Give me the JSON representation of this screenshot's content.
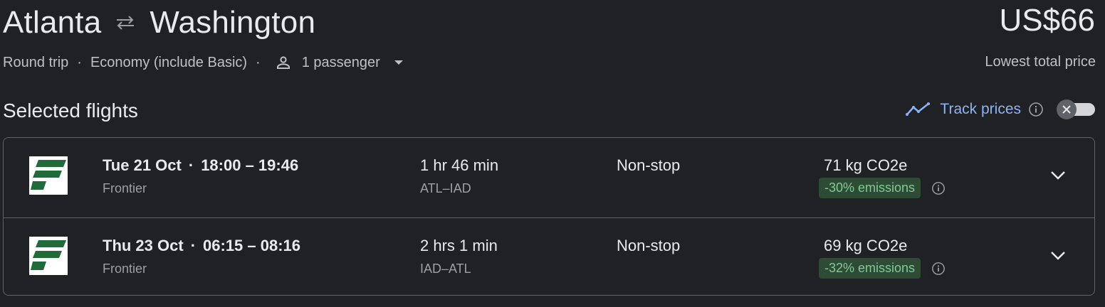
{
  "header": {
    "origin": "Atlanta",
    "destination": "Washington",
    "swap_icon": "swap-arrows-icon",
    "price": "US$66",
    "price_caption": "Lowest total price",
    "trip_type": "Round trip",
    "cabin": "Economy (include Basic)",
    "passengers": "1 passenger"
  },
  "section": {
    "title": "Selected flights",
    "track_label": "Track prices"
  },
  "flights": [
    {
      "date": "Tue 21 Oct",
      "times": "18:00 – 19:46",
      "airline": "Frontier",
      "duration": "1 hr 46 min",
      "route": "ATL–IAD",
      "stops": "Non-stop",
      "co2": "71 kg CO2e",
      "emissions": "-30% emissions"
    },
    {
      "date": "Thu 23 Oct",
      "times": "06:15 – 08:16",
      "airline": "Frontier",
      "duration": "2 hrs 1 min",
      "route": "IAD–ATL",
      "stops": "Non-stop",
      "co2": "69 kg CO2e",
      "emissions": "-32% emissions"
    }
  ],
  "colors": {
    "background": "#202124",
    "accent": "#8ab4f8",
    "emissions_badge_bg": "#2e4b36",
    "emissions_badge_text": "#81c995",
    "frontier_green": "#1f6b3a"
  }
}
